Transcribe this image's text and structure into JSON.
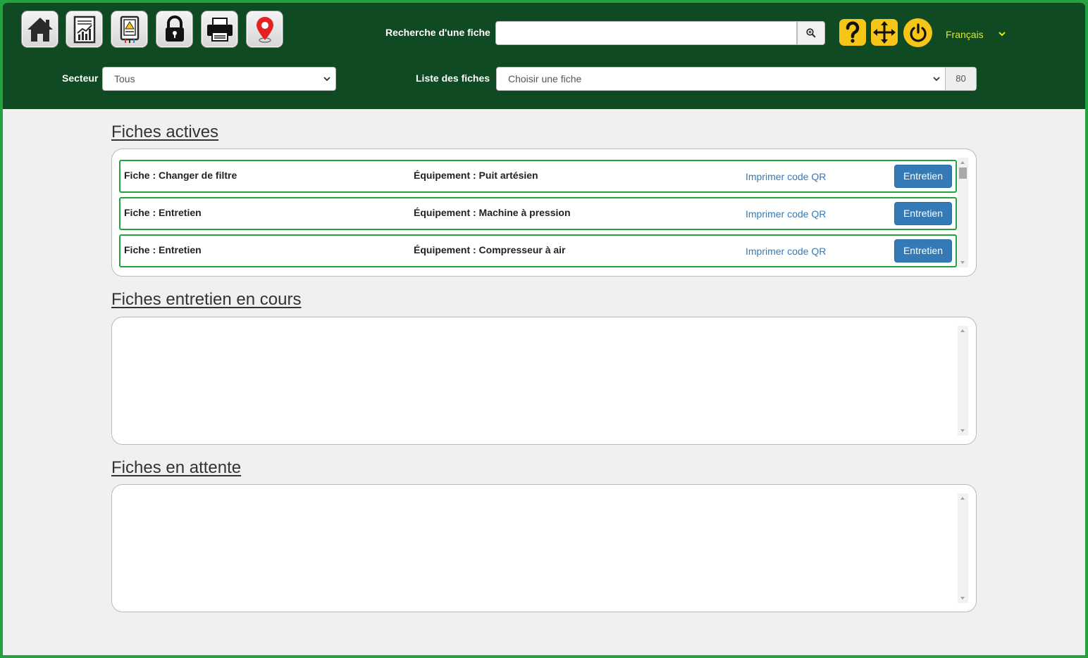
{
  "header": {
    "toolbar": [
      {
        "name": "home-icon"
      },
      {
        "name": "report-chart-icon"
      },
      {
        "name": "electrical-panel-icon"
      },
      {
        "name": "lock-icon"
      },
      {
        "name": "printer-icon"
      },
      {
        "name": "map-pin-icon"
      }
    ],
    "search_label": "Recherche d'une fiche",
    "search_value": "",
    "secteur_label": "Secteur",
    "secteur_value": "Tous",
    "liste_label": "Liste des fiches",
    "liste_value": "Choisir une fiche",
    "fiche_count": "80",
    "language": "Français",
    "accent_colors": {
      "header_bg": "#0f4a22",
      "frame": "#22a33d",
      "yellow": "#f5c518",
      "lang": "#e5e81a",
      "button": "#337ab7"
    }
  },
  "sections": [
    {
      "title": "Fiches actives",
      "rows": [
        {
          "fiche": "Fiche : Changer de filtre",
          "equipement": "Équipement : Puit artésien",
          "qr": "Imprimer code QR",
          "action": "Entretien"
        },
        {
          "fiche": "Fiche : Entretien",
          "equipement": "Équipement : Machine à pression",
          "qr": "Imprimer code QR",
          "action": "Entretien"
        },
        {
          "fiche": "Fiche : Entretien",
          "equipement": "Équipement : Compresseur à air",
          "qr": "Imprimer code QR",
          "action": "Entretien"
        }
      ]
    },
    {
      "title": "Fiches entretien en cours",
      "rows": []
    },
    {
      "title": "Fiches en attente",
      "rows": []
    }
  ]
}
